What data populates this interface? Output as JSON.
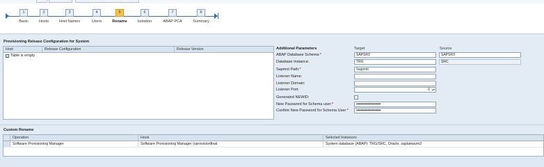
{
  "roadmap": {
    "steps": [
      {
        "num": "1",
        "label": "Basic"
      },
      {
        "num": "2",
        "label": "Hosts"
      },
      {
        "num": "3",
        "label": "Host Names"
      },
      {
        "num": "4",
        "label": "Users"
      },
      {
        "num": "5",
        "label": "Rename"
      },
      {
        "num": "6",
        "label": "Isolation"
      },
      {
        "num": "7",
        "label": "ABAP PCA"
      },
      {
        "num": "8",
        "label": "Summary"
      }
    ],
    "active_step": "5"
  },
  "provisioning": {
    "title": "Provisioning Release Configuration for System",
    "columns": [
      "Host",
      "Release Configuration",
      "Release Version"
    ],
    "empty_text": "Table is empty"
  },
  "params": {
    "title": "Additional Parameters",
    "target_header": "Target",
    "source_header": "Source",
    "rows": [
      {
        "label": "ABAP Database Schema:",
        "required": "*",
        "target": "SAPSR3",
        "source": "SAPSR3"
      },
      {
        "label": "Database Instance:",
        "required": "",
        "target": "TRG",
        "source": "SRC"
      },
      {
        "label": "Sapmnt Path:",
        "required": "*",
        "target": "/sapmnt",
        "source": ""
      },
      {
        "label": "Listener Name:",
        "required": "",
        "target": "",
        "source": ""
      },
      {
        "label": "Listener Domain:",
        "required": "",
        "target": "",
        "source": ""
      },
      {
        "label": "Listener Port:",
        "required": "",
        "target": "-1",
        "source": ""
      },
      {
        "label": "Generated NEWID:",
        "required": "",
        "target": "",
        "source": ""
      },
      {
        "label": "New Password for Schema user:",
        "required": "*",
        "target": "••••••••••••••••••••••••••••",
        "source": ""
      },
      {
        "label": "Confirm New Password for Schema User:",
        "required": "*",
        "target": "••••••••••••••••••••••••••••",
        "source": ""
      }
    ]
  },
  "custom_rename": {
    "title": "Custom Rename",
    "columns": [
      "Operation",
      "Hook",
      "Selected Instances"
    ],
    "rows": [
      {
        "operation": "Software Provisioning Manager",
        "hook": "Software Provisioning Manager (vprovisionfinal",
        "instances": "System database (ABAP): TRG/SRC, Oracle, saplamavm2"
      }
    ]
  },
  "colors": {
    "active_step": "#f6c34a",
    "roadmap_line": "#3a6f9f",
    "panel_bg": "#e3ecf5",
    "required": "#cc0000"
  }
}
